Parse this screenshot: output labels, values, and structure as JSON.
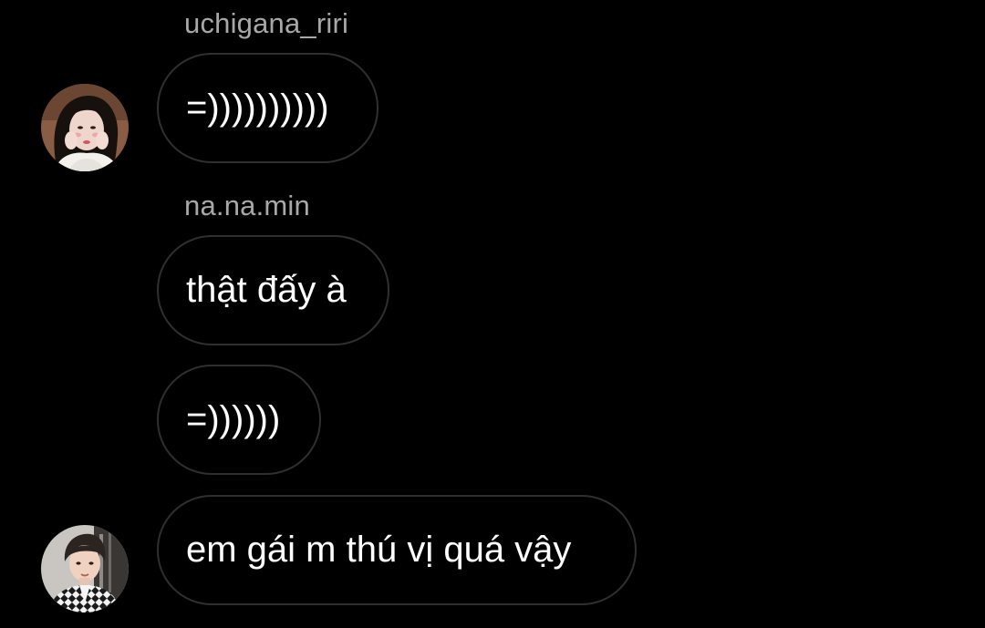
{
  "messages": [
    {
      "sender": "uchigana_riri",
      "text": "=))))))))))"
    },
    {
      "sender": "na.na.min",
      "text": "thật đấy à"
    },
    {
      "text": "=))))))"
    },
    {
      "text": "em gái m thú vị quá vậy"
    }
  ],
  "avatars": {
    "riri": "avatar-girl-photo",
    "nanamin": "avatar-boy-photo"
  },
  "colors": {
    "background": "#000000",
    "bubble_border": "#2f2f2f",
    "sender_name": "#a8a8a8",
    "text": "#ffffff"
  }
}
